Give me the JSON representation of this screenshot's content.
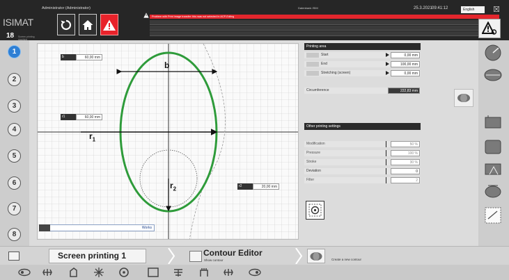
{
  "app": {
    "brand": "ISIMAT",
    "machine_no": "18",
    "brand_sub": "Screen printing machine",
    "user": "Administrator (Administrator)",
    "session": "Datenbank   ISIM",
    "date": "25.3.2021",
    "time": "09:41:12",
    "language": "English",
    "error_message": "Problem with Print image transfer: this was not selected in ACP-Edting"
  },
  "stations": [
    "1",
    "2",
    "3",
    "4",
    "5",
    "6",
    "7",
    "8"
  ],
  "active_station": "1",
  "editor": {
    "dim_b_label": "b",
    "dim_r1_label": "r",
    "dim_r1_sub": "1",
    "dim_r2_label": "r",
    "dim_r2_sub": "2",
    "field_b": {
      "tag": "b",
      "value": "60,00 mm"
    },
    "field_r1": {
      "tag": "r1",
      "value": "60,00 mm"
    },
    "field_r2": {
      "tag": "r2",
      "value": "20,00 mm"
    },
    "status_text": "Works"
  },
  "printing_area": {
    "title": "Printing area",
    "rows": [
      {
        "label": "Start",
        "value": "0,00 mm"
      },
      {
        "label": "End",
        "value": "100,00 mm"
      },
      {
        "label": "Stretching (screen)",
        "value": "0,00 mm"
      }
    ],
    "circumference_label": "Circumference",
    "circumference_value": "222,83 mm"
  },
  "other_settings": {
    "title": "Other printing settings",
    "rows": [
      {
        "label": "Modification",
        "value": "50 %"
      },
      {
        "label": "Pressure",
        "value": "100 %"
      },
      {
        "label": "Stroke",
        "value": "30 %"
      },
      {
        "label": "Deviation",
        "value": "0"
      },
      {
        "label": "Filter",
        "value": "2"
      }
    ]
  },
  "breadcrumbs": {
    "item1": "Screen printing 1",
    "item2_title": "Contour Editor",
    "item2_sub": "Show contour",
    "item3_sub": "Create a new contour"
  },
  "colors": {
    "ellipse": "#2e9b3a",
    "alert": "#e8222a",
    "active_station": "#2e7fd4"
  }
}
